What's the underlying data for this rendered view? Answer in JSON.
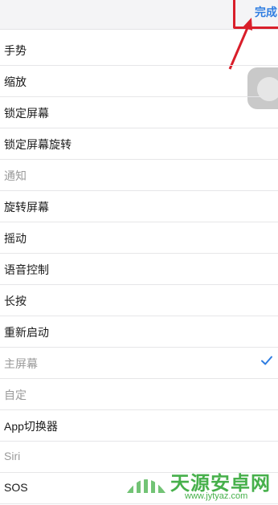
{
  "header": {
    "done_label": "完成"
  },
  "list": {
    "items": [
      {
        "label": "手势",
        "disabled": false,
        "checked": false
      },
      {
        "label": "缩放",
        "disabled": false,
        "checked": false
      },
      {
        "label": "锁定屏幕",
        "disabled": false,
        "checked": false
      },
      {
        "label": "锁定屏幕旋转",
        "disabled": false,
        "checked": false
      },
      {
        "label": "通知",
        "disabled": true,
        "checked": false
      },
      {
        "label": "旋转屏幕",
        "disabled": false,
        "checked": false
      },
      {
        "label": "摇动",
        "disabled": false,
        "checked": false
      },
      {
        "label": "语音控制",
        "disabled": false,
        "checked": false
      },
      {
        "label": "长按",
        "disabled": false,
        "checked": false
      },
      {
        "label": "重新启动",
        "disabled": false,
        "checked": false
      },
      {
        "label": "主屏幕",
        "disabled": true,
        "checked": true
      },
      {
        "label": "自定",
        "disabled": true,
        "checked": false
      },
      {
        "label": "App切换器",
        "disabled": false,
        "checked": false
      },
      {
        "label": "Siri",
        "disabled": true,
        "checked": false
      },
      {
        "label": "SOS",
        "disabled": false,
        "checked": false
      }
    ]
  },
  "watermark": {
    "name": "天源安卓网",
    "url": "www.jytyaz.com"
  },
  "colors": {
    "accent": "#2f7de1",
    "highlight": "#d91e2a",
    "watermark": "#47b04b"
  }
}
